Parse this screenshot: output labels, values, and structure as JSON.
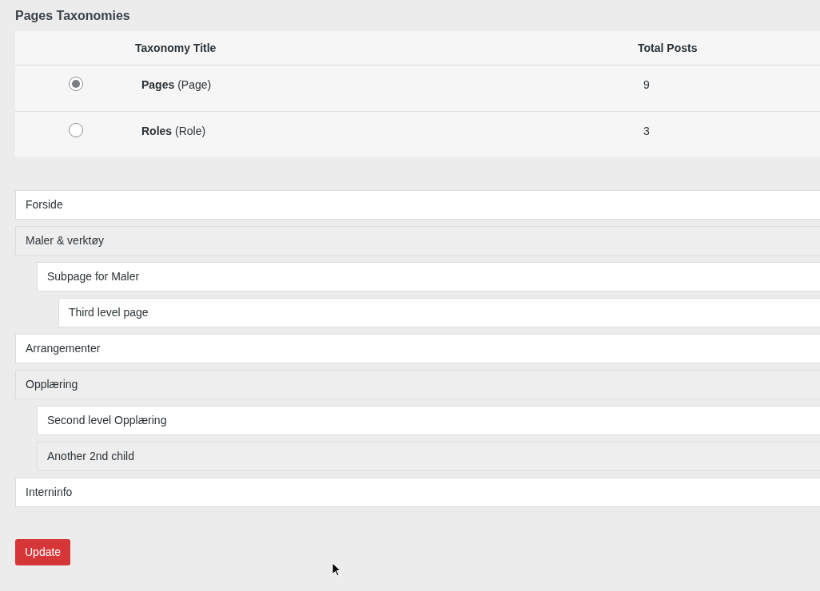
{
  "section_title": "Pages Taxonomies",
  "table": {
    "columns": [
      "Taxonomy Title",
      "Total Posts"
    ],
    "rows": [
      {
        "title": "**Pages** (Page)",
        "total": "9",
        "selected": true
      },
      {
        "title": "**Roles** (Role)",
        "total": "3",
        "selected": false
      }
    ]
  },
  "pages": [
    {
      "label": "Forside",
      "shaded": false
    },
    {
      "label": "Maler & verktøy",
      "shaded": true,
      "children": [
        {
          "label": "Subpage for Maler",
          "shaded": false,
          "children": [
            {
              "label": "Third level page",
              "shaded": false
            }
          ]
        }
      ]
    },
    {
      "label": "Arrangementer",
      "shaded": false
    },
    {
      "label": "Opplæring",
      "shaded": true,
      "children": [
        {
          "label": "Second level Opplæring",
          "shaded": false
        },
        {
          "label": "Another 2nd child",
          "shaded": true
        }
      ]
    },
    {
      "label": "Interninfo",
      "shaded": false
    }
  ],
  "update_button": "Update"
}
